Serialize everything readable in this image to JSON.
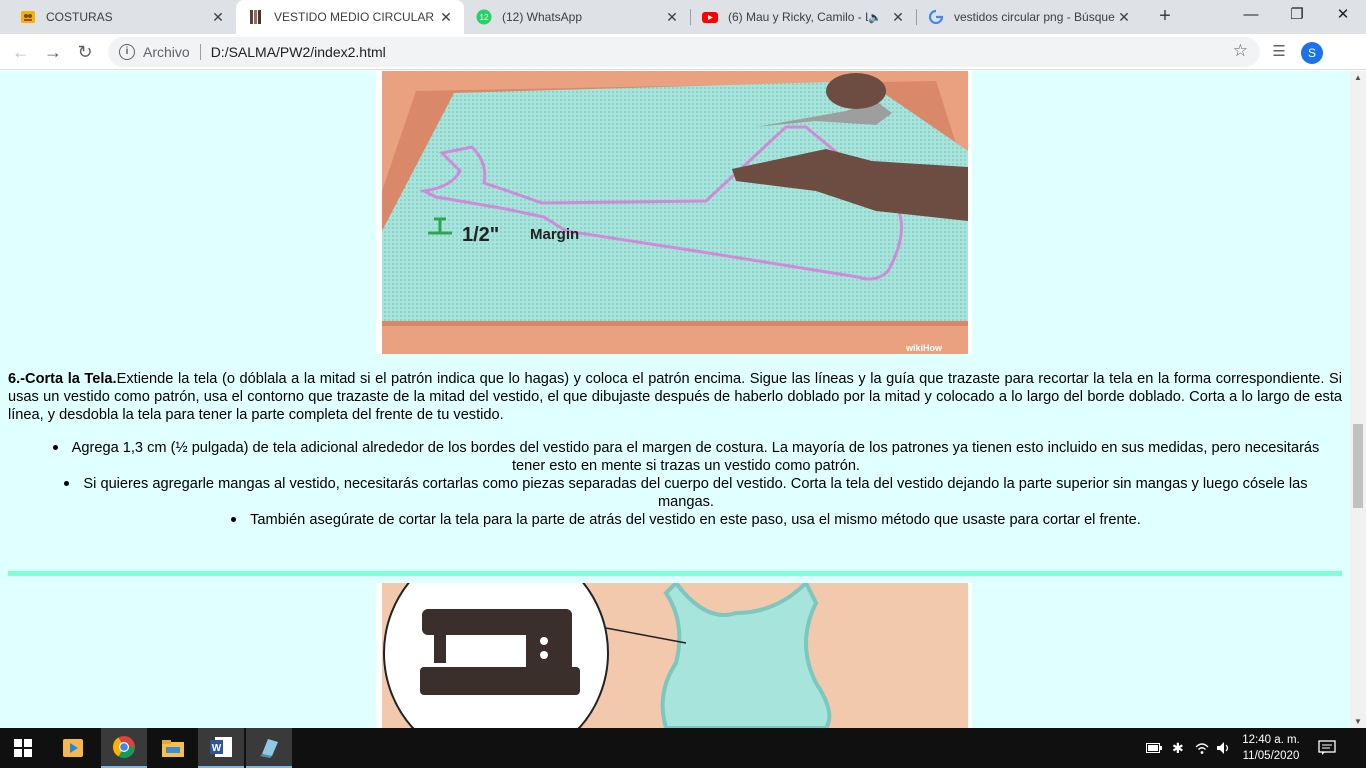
{
  "tabs": [
    {
      "title": "COSTURAS",
      "favicon": "sewing-favicon",
      "active": false
    },
    {
      "title": "VESTIDO MEDIO CIRCULAR",
      "favicon": "dress-favicon",
      "active": true
    },
    {
      "title": "(12) WhatsApp",
      "favicon": "whatsapp-icon",
      "badge": "12",
      "active": false
    },
    {
      "title": "(6) Mau y Ricky, Camilo - L",
      "favicon": "youtube-icon",
      "active": false
    },
    {
      "title": "vestidos circular png - Búsque",
      "favicon": "google-icon",
      "active": false
    }
  ],
  "address": {
    "scheme_label": "Archivo",
    "url": "D:/SALMA/PW2/index2.html"
  },
  "profile_initial": "S",
  "step1_image": {
    "label_text": "1/2\"",
    "label_word": "Margin",
    "watermark": "wikiHow"
  },
  "content": {
    "heading": "6.-Corta la Tela.",
    "paragraph": "Extiende la tela (o dóblala a la mitad si el patrón indica que lo hagas) y coloca el patrón encima. Sigue las líneas y la guía que trazaste para recortar la tela en la forma correspondiente. Si usas un vestido como patrón, usa el contorno que trazaste de la mitad del vestido, el que dibujaste después de haberlo doblado por la mitad y colocado a lo largo del borde doblado. Corta a lo largo de esta línea, y desdobla la tela para tener la parte completa del frente de tu vestido.",
    "bullets": [
      "Agrega 1,3 cm (½ pulgada) de tela adicional alrededor de los bordes del vestido para el margen de costura. La mayoría de los patrones ya tienen esto incluido en sus medidas, pero necesitarás tener esto en mente si trazas un vestido como patrón.",
      "Si quieres agregarle mangas al vestido, necesitarás cortarlas como piezas separadas del cuerpo del vestido. Corta la tela del vestido dejando la parte superior sin mangas y luego cósele las mangas.",
      "También asegúrate de cortar la tela para la parte de atrás del vestido en este paso, usa el mismo método que usaste para cortar el frente."
    ]
  },
  "taskbar": {
    "time": "12:40 a. m.",
    "date": "11/05/2020"
  },
  "colors": {
    "page_bg": "#e0ffff",
    "divider": "#7fffd4",
    "tabstrip_bg": "#dee1e6"
  }
}
